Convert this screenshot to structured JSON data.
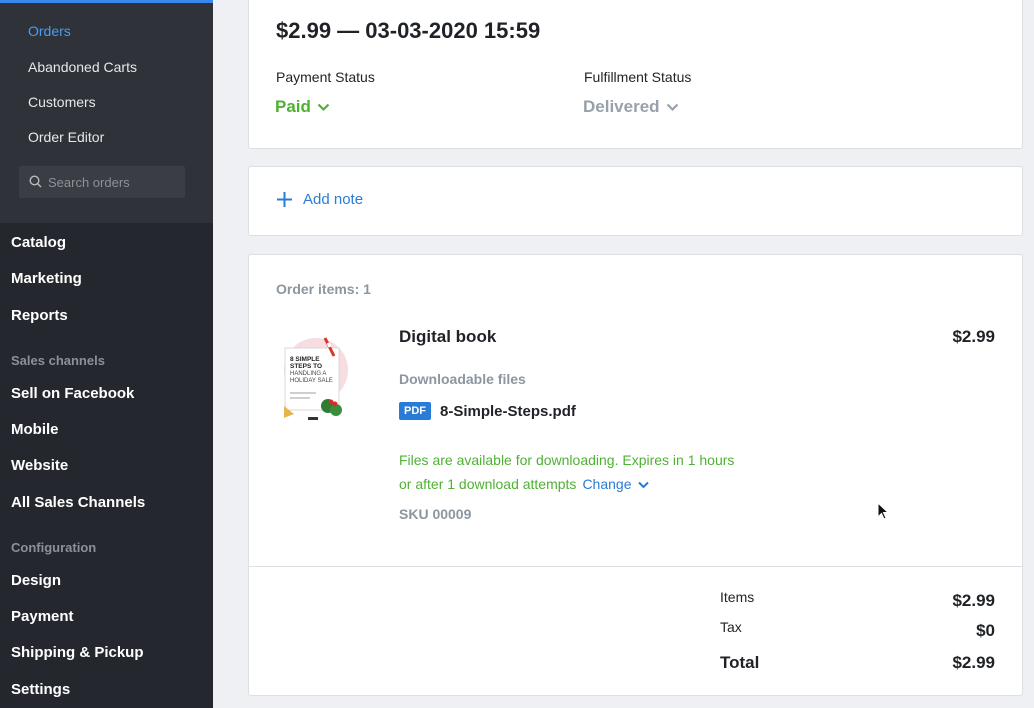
{
  "sidebar": {
    "sub_items": [
      "Orders",
      "Abandoned Carts",
      "Customers",
      "Order Editor"
    ],
    "search_placeholder": "Search orders",
    "nav_main": [
      "Catalog",
      "Marketing",
      "Reports"
    ],
    "section_sales": "Sales channels",
    "nav_sales": [
      "Sell on Facebook",
      "Mobile",
      "Website",
      "All Sales Channels"
    ],
    "section_config": "Configuration",
    "nav_config": [
      "Design",
      "Payment",
      "Shipping & Pickup",
      "Settings"
    ]
  },
  "order": {
    "title": "$2.99 — 03-03-2020 15:59",
    "payment_label": "Payment Status",
    "payment_value": "Paid",
    "fulfillment_label": "Fulfillment Status",
    "fulfillment_value": "Delivered"
  },
  "note": {
    "add_label": "Add note"
  },
  "items": {
    "header": "Order items: 1",
    "product_name": "Digital book",
    "product_price": "$2.99",
    "downloadable_label": "Downloadable files",
    "file_badge": "PDF",
    "file_name": "8-Simple-Steps.pdf",
    "availability": "Files are available for downloading. Expires in 1 hours or after 1 download attempts",
    "change_label": "Change",
    "sku": "SKU  00009",
    "thumb_text": [
      "8 SIMPLE",
      "STEPS TO",
      "HANDLING A",
      "HOLIDAY SALE"
    ]
  },
  "totals": {
    "items_label": "Items",
    "items_value": "$2.99",
    "tax_label": "Tax",
    "tax_value": "$0",
    "total_label": "Total",
    "total_value": "$2.99"
  },
  "colors": {
    "accent": "#2a7bd6",
    "success": "#4fb133",
    "sidebar": "#24272e"
  }
}
